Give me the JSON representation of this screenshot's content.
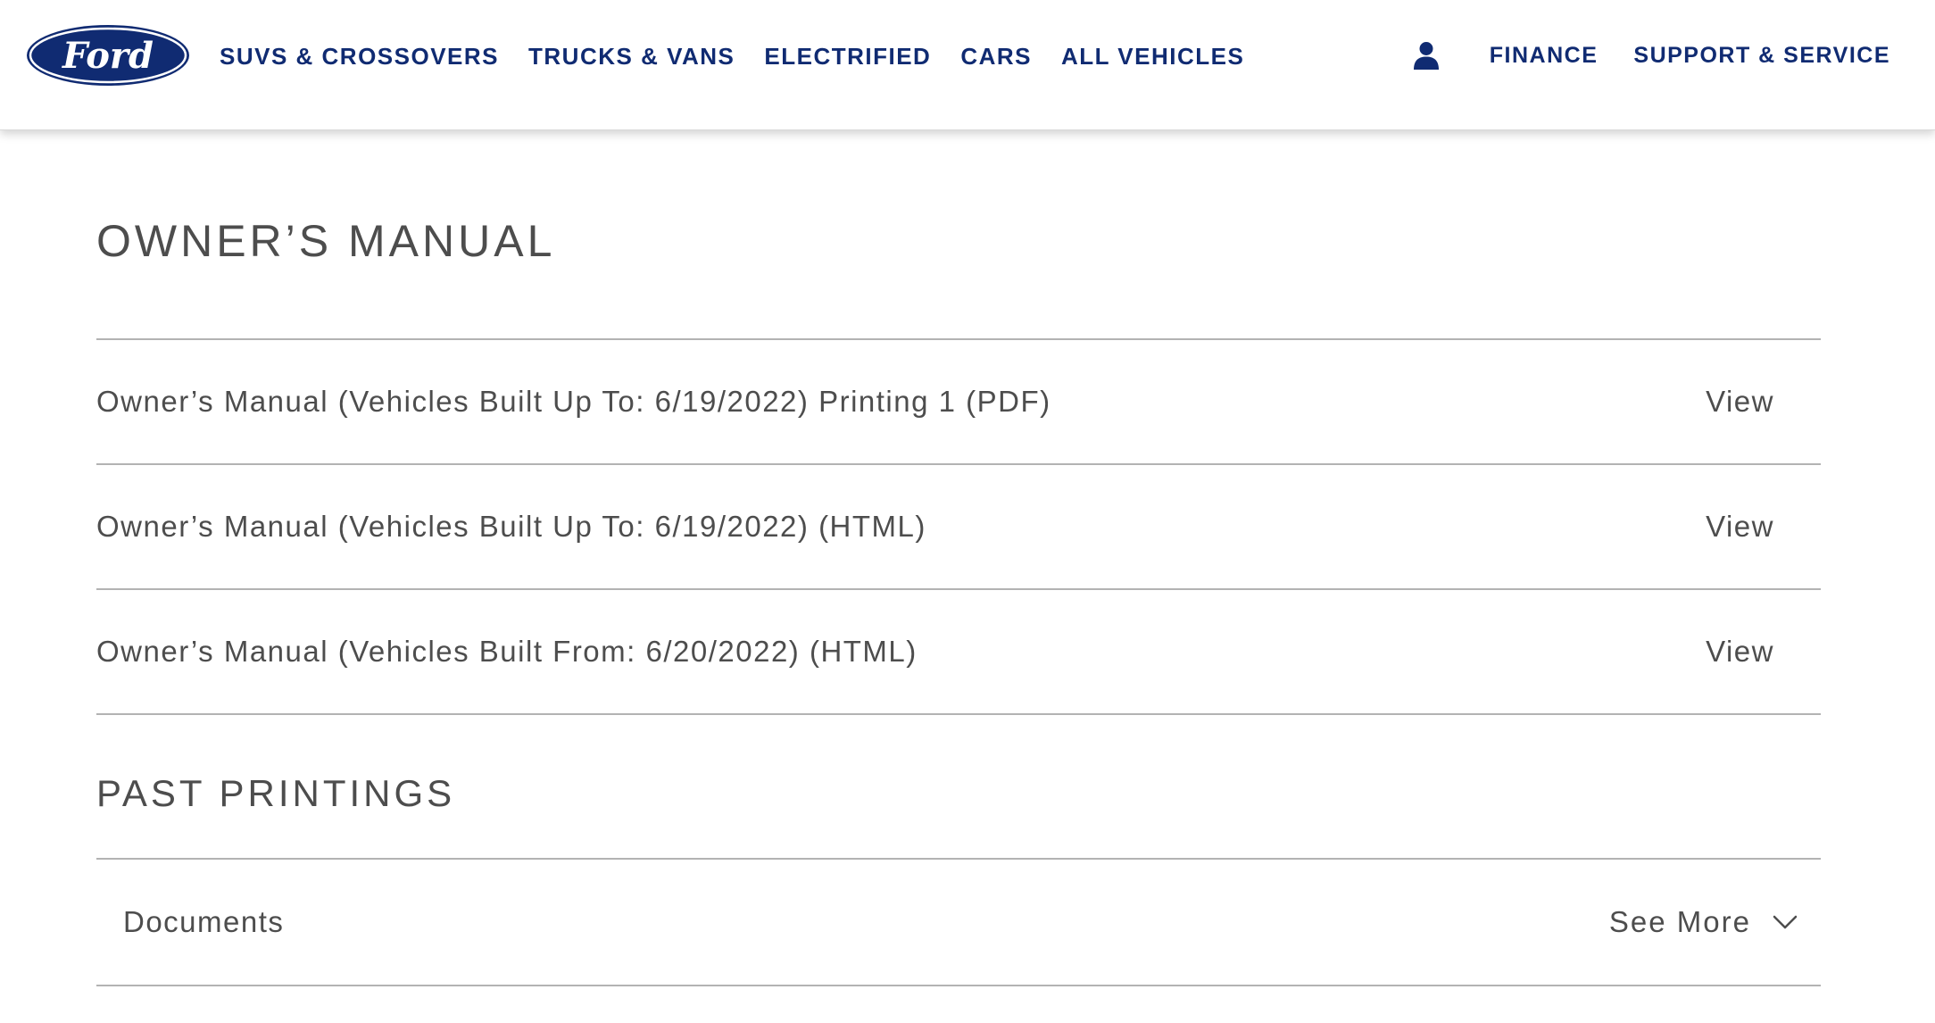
{
  "header": {
    "logo_text": "Ford",
    "brand_color": "#102b72",
    "nav_left": [
      {
        "label": "SUVS & CROSSOVERS"
      },
      {
        "label": "TRUCKS & VANS"
      },
      {
        "label": "ELECTRIFIED"
      },
      {
        "label": "CARS"
      },
      {
        "label": "ALL VEHICLES"
      }
    ],
    "account_icon": "person-icon",
    "nav_right": [
      {
        "label": "FINANCE"
      },
      {
        "label": "SUPPORT & SERVICE"
      }
    ]
  },
  "owners_manual": {
    "title": "OWNER’S MANUAL",
    "rows": [
      {
        "label": "Owner’s Manual (Vehicles Built Up To: 6/19/2022) Printing 1 (PDF)",
        "action": "View"
      },
      {
        "label": "Owner’s Manual (Vehicles Built Up To: 6/19/2022) (HTML)",
        "action": "View"
      },
      {
        "label": "Owner’s Manual (Vehicles Built From: 6/20/2022) (HTML)",
        "action": "View"
      }
    ]
  },
  "past_printings": {
    "title": "PAST PRINTINGS",
    "documents_label": "Documents",
    "see_more_label": "See More",
    "see_more_icon": "chevron-down-icon"
  }
}
